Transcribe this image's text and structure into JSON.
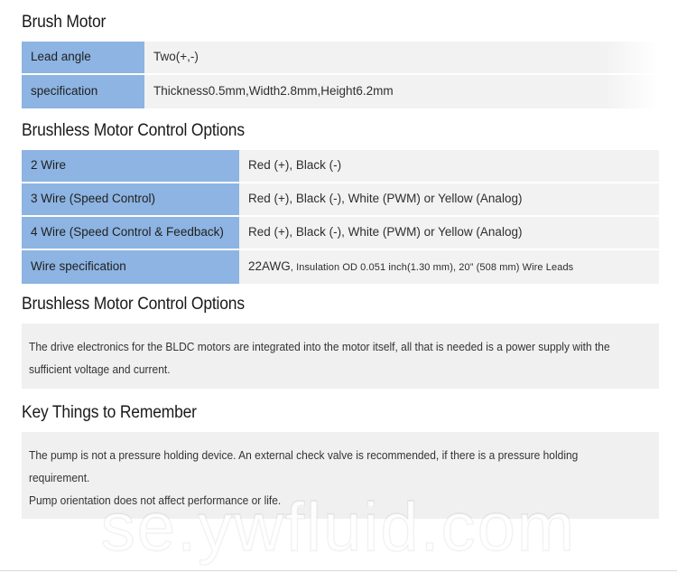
{
  "sections": [
    {
      "heading": "Brush Motor",
      "rows": [
        {
          "key": "Lead angle",
          "value": "Two(+,-)"
        },
        {
          "key": "specification",
          "value": "Thickness0.5mm,Width2.8mm,Height6.2mm"
        }
      ]
    },
    {
      "heading": "Brushless Motor Control Options",
      "rows": [
        {
          "key": "2 Wire",
          "value": "Red (+), Black (-)"
        },
        {
          "key": "3 Wire (Speed Control)",
          "value": "Red (+), Black (-), White (PWM) or Yellow (Analog)"
        },
        {
          "key": "4 Wire (Speed Control & Feedback)",
          "value": "Red (+), Black (-), White (PWM) or Yellow (Analog)"
        },
        {
          "key": "Wire specification",
          "value_big": "22AWG",
          "value_small": ", Insulation OD 0.051 inch(1.30 mm), 20” (508 mm) Wire Leads"
        }
      ]
    },
    {
      "heading": "Brushless Motor Control Options",
      "paragraphs": [
        "The drive electronics for the BLDC motors are integrated into the motor itself, all that is needed is a power supply with the sufficient voltage and current."
      ]
    },
    {
      "heading": "Key Things to Remember",
      "paragraphs": [
        "The pump is not a pressure holding device. An external check valve is recommended, if there is a pressure holding requirement.",
        "Pump orientation does not affect performance or life."
      ]
    }
  ],
  "watermark": {
    "text": "se.ywfluid.com"
  },
  "colors": {
    "key_cell": "#8db4e2",
    "value_cell": "#f2f2f2",
    "info_box": "#f0f0f0",
    "heading_text": "#1a1a1a"
  }
}
